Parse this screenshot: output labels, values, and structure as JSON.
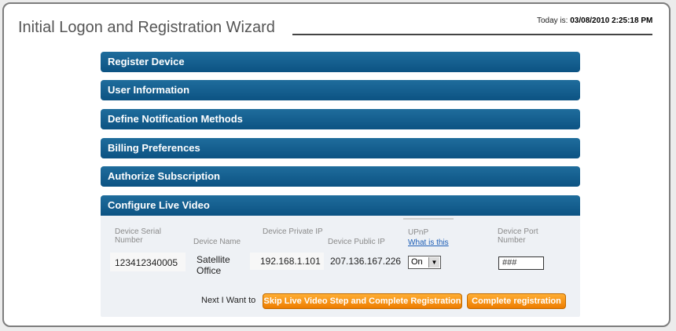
{
  "header": {
    "title": "Initial Logon and Registration Wizard",
    "today_label": "Today is:",
    "today_value": "03/08/2010 2:25:18 PM"
  },
  "sections": [
    {
      "label": "Register Device"
    },
    {
      "label": "User Information"
    },
    {
      "label": "Define Notification Methods"
    },
    {
      "label": "Billing Preferences"
    },
    {
      "label": "Authorize Subscription"
    },
    {
      "label": "Configure Live Video"
    }
  ],
  "live_video": {
    "headers": {
      "serial": "Device Serial Number",
      "name": "Device Name",
      "private_ip": "Device Private IP",
      "public_ip": "Device Public IP",
      "upnp": "UPnP",
      "upnp_help": "What is this",
      "port": "Device Port Number"
    },
    "values": {
      "serial": "123412340005",
      "name": "Satellite Office",
      "private_ip": "192.168.1.101",
      "public_ip": "207.136.167.226",
      "upnp_selected": "On",
      "port_value": "###"
    },
    "next_label": "Next I Want to",
    "skip_button": "Skip Live Video Step and Complete Registration",
    "complete_button": "Complete registration"
  },
  "colors": {
    "bar": "#0c5383",
    "button": "#ee7d00"
  }
}
